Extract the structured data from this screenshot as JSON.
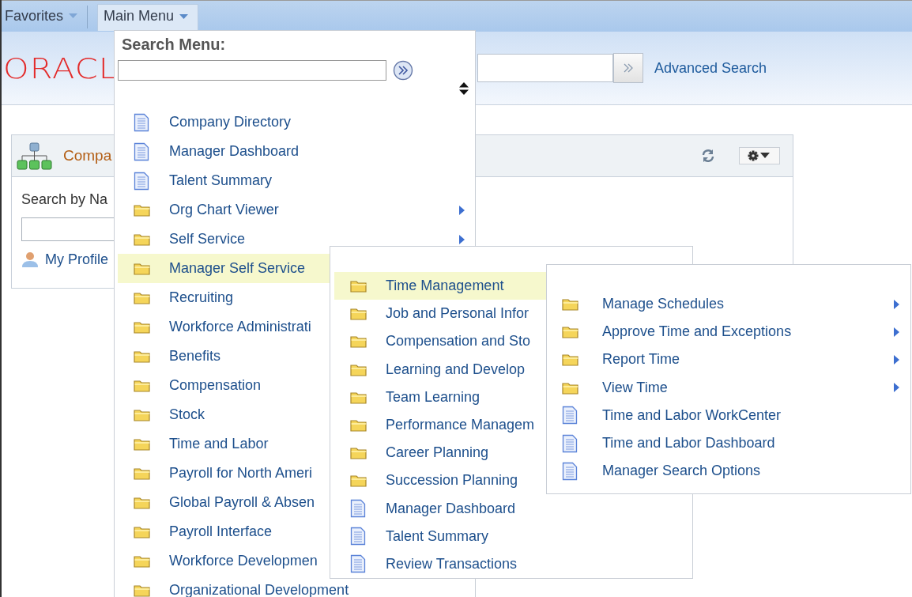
{
  "nav": [
    {
      "label": "Favorites",
      "selected": false
    },
    {
      "label": "Main Menu",
      "selected": true
    }
  ],
  "header": {
    "logo": "ORACL",
    "advanced_search": "Advanced Search"
  },
  "pagelet": {
    "title": "Compa",
    "search_label": "Search by Na",
    "profile_link": "My Profile"
  },
  "main_menu": {
    "search_label": "Search Menu:",
    "items": [
      {
        "kind": "page",
        "label": "Company Directory",
        "submenu": false,
        "selected": false
      },
      {
        "kind": "page",
        "label": "Manager Dashboard",
        "submenu": false,
        "selected": false
      },
      {
        "kind": "page",
        "label": "Talent Summary",
        "submenu": false,
        "selected": false
      },
      {
        "kind": "folder",
        "label": "Org Chart Viewer",
        "submenu": true,
        "selected": false
      },
      {
        "kind": "folder",
        "label": "Self Service",
        "submenu": true,
        "selected": false
      },
      {
        "kind": "folder",
        "label": "Manager Self Service",
        "submenu": false,
        "selected": true
      },
      {
        "kind": "folder",
        "label": "Recruiting",
        "submenu": false,
        "selected": false
      },
      {
        "kind": "folder",
        "label": "Workforce Administrati",
        "submenu": false,
        "selected": false
      },
      {
        "kind": "folder",
        "label": "Benefits",
        "submenu": false,
        "selected": false
      },
      {
        "kind": "folder",
        "label": "Compensation",
        "submenu": false,
        "selected": false
      },
      {
        "kind": "folder",
        "label": "Stock",
        "submenu": false,
        "selected": false
      },
      {
        "kind": "folder",
        "label": "Time and Labor",
        "submenu": false,
        "selected": false
      },
      {
        "kind": "folder",
        "label": "Payroll for North Ameri",
        "submenu": false,
        "selected": false
      },
      {
        "kind": "folder",
        "label": "Global Payroll & Absen",
        "submenu": false,
        "selected": false
      },
      {
        "kind": "folder",
        "label": "Payroll Interface",
        "submenu": false,
        "selected": false
      },
      {
        "kind": "folder",
        "label": "Workforce Developmen",
        "submenu": false,
        "selected": false
      },
      {
        "kind": "folder",
        "label": "Organizational Development",
        "submenu": false,
        "selected": false
      }
    ]
  },
  "submenu": {
    "items": [
      {
        "kind": "folder",
        "label": "Time Management",
        "submenu": false,
        "selected": true
      },
      {
        "kind": "folder",
        "label": "Job and Personal Infor",
        "submenu": false,
        "selected": false
      },
      {
        "kind": "folder",
        "label": "Compensation and Sto",
        "submenu": false,
        "selected": false
      },
      {
        "kind": "folder",
        "label": "Learning and Develop",
        "submenu": false,
        "selected": false
      },
      {
        "kind": "folder",
        "label": "Team Learning",
        "submenu": false,
        "selected": false
      },
      {
        "kind": "folder",
        "label": "Performance Managem",
        "submenu": false,
        "selected": false
      },
      {
        "kind": "folder",
        "label": "Career Planning",
        "submenu": false,
        "selected": false
      },
      {
        "kind": "folder",
        "label": "Succession Planning",
        "submenu": false,
        "selected": false
      },
      {
        "kind": "page",
        "label": "Manager Dashboard",
        "submenu": false,
        "selected": false
      },
      {
        "kind": "page",
        "label": "Talent Summary",
        "submenu": false,
        "selected": false
      },
      {
        "kind": "page",
        "label": "Review Transactions",
        "submenu": false,
        "selected": false
      }
    ]
  },
  "submenu_2": {
    "items": [
      {
        "kind": "folder",
        "label": "Manage Schedules",
        "submenu": true,
        "selected": false
      },
      {
        "kind": "folder",
        "label": "Approve Time and Exceptions",
        "submenu": true,
        "selected": false
      },
      {
        "kind": "folder",
        "label": "Report Time",
        "submenu": true,
        "selected": false
      },
      {
        "kind": "folder",
        "label": "View Time",
        "submenu": true,
        "selected": false
      },
      {
        "kind": "page",
        "label": "Time and Labor WorkCenter",
        "submenu": false,
        "selected": false
      },
      {
        "kind": "page",
        "label": "Time and Labor Dashboard",
        "submenu": false,
        "selected": false
      },
      {
        "kind": "page",
        "label": "Manager Search Options",
        "submenu": false,
        "selected": false
      }
    ]
  }
}
